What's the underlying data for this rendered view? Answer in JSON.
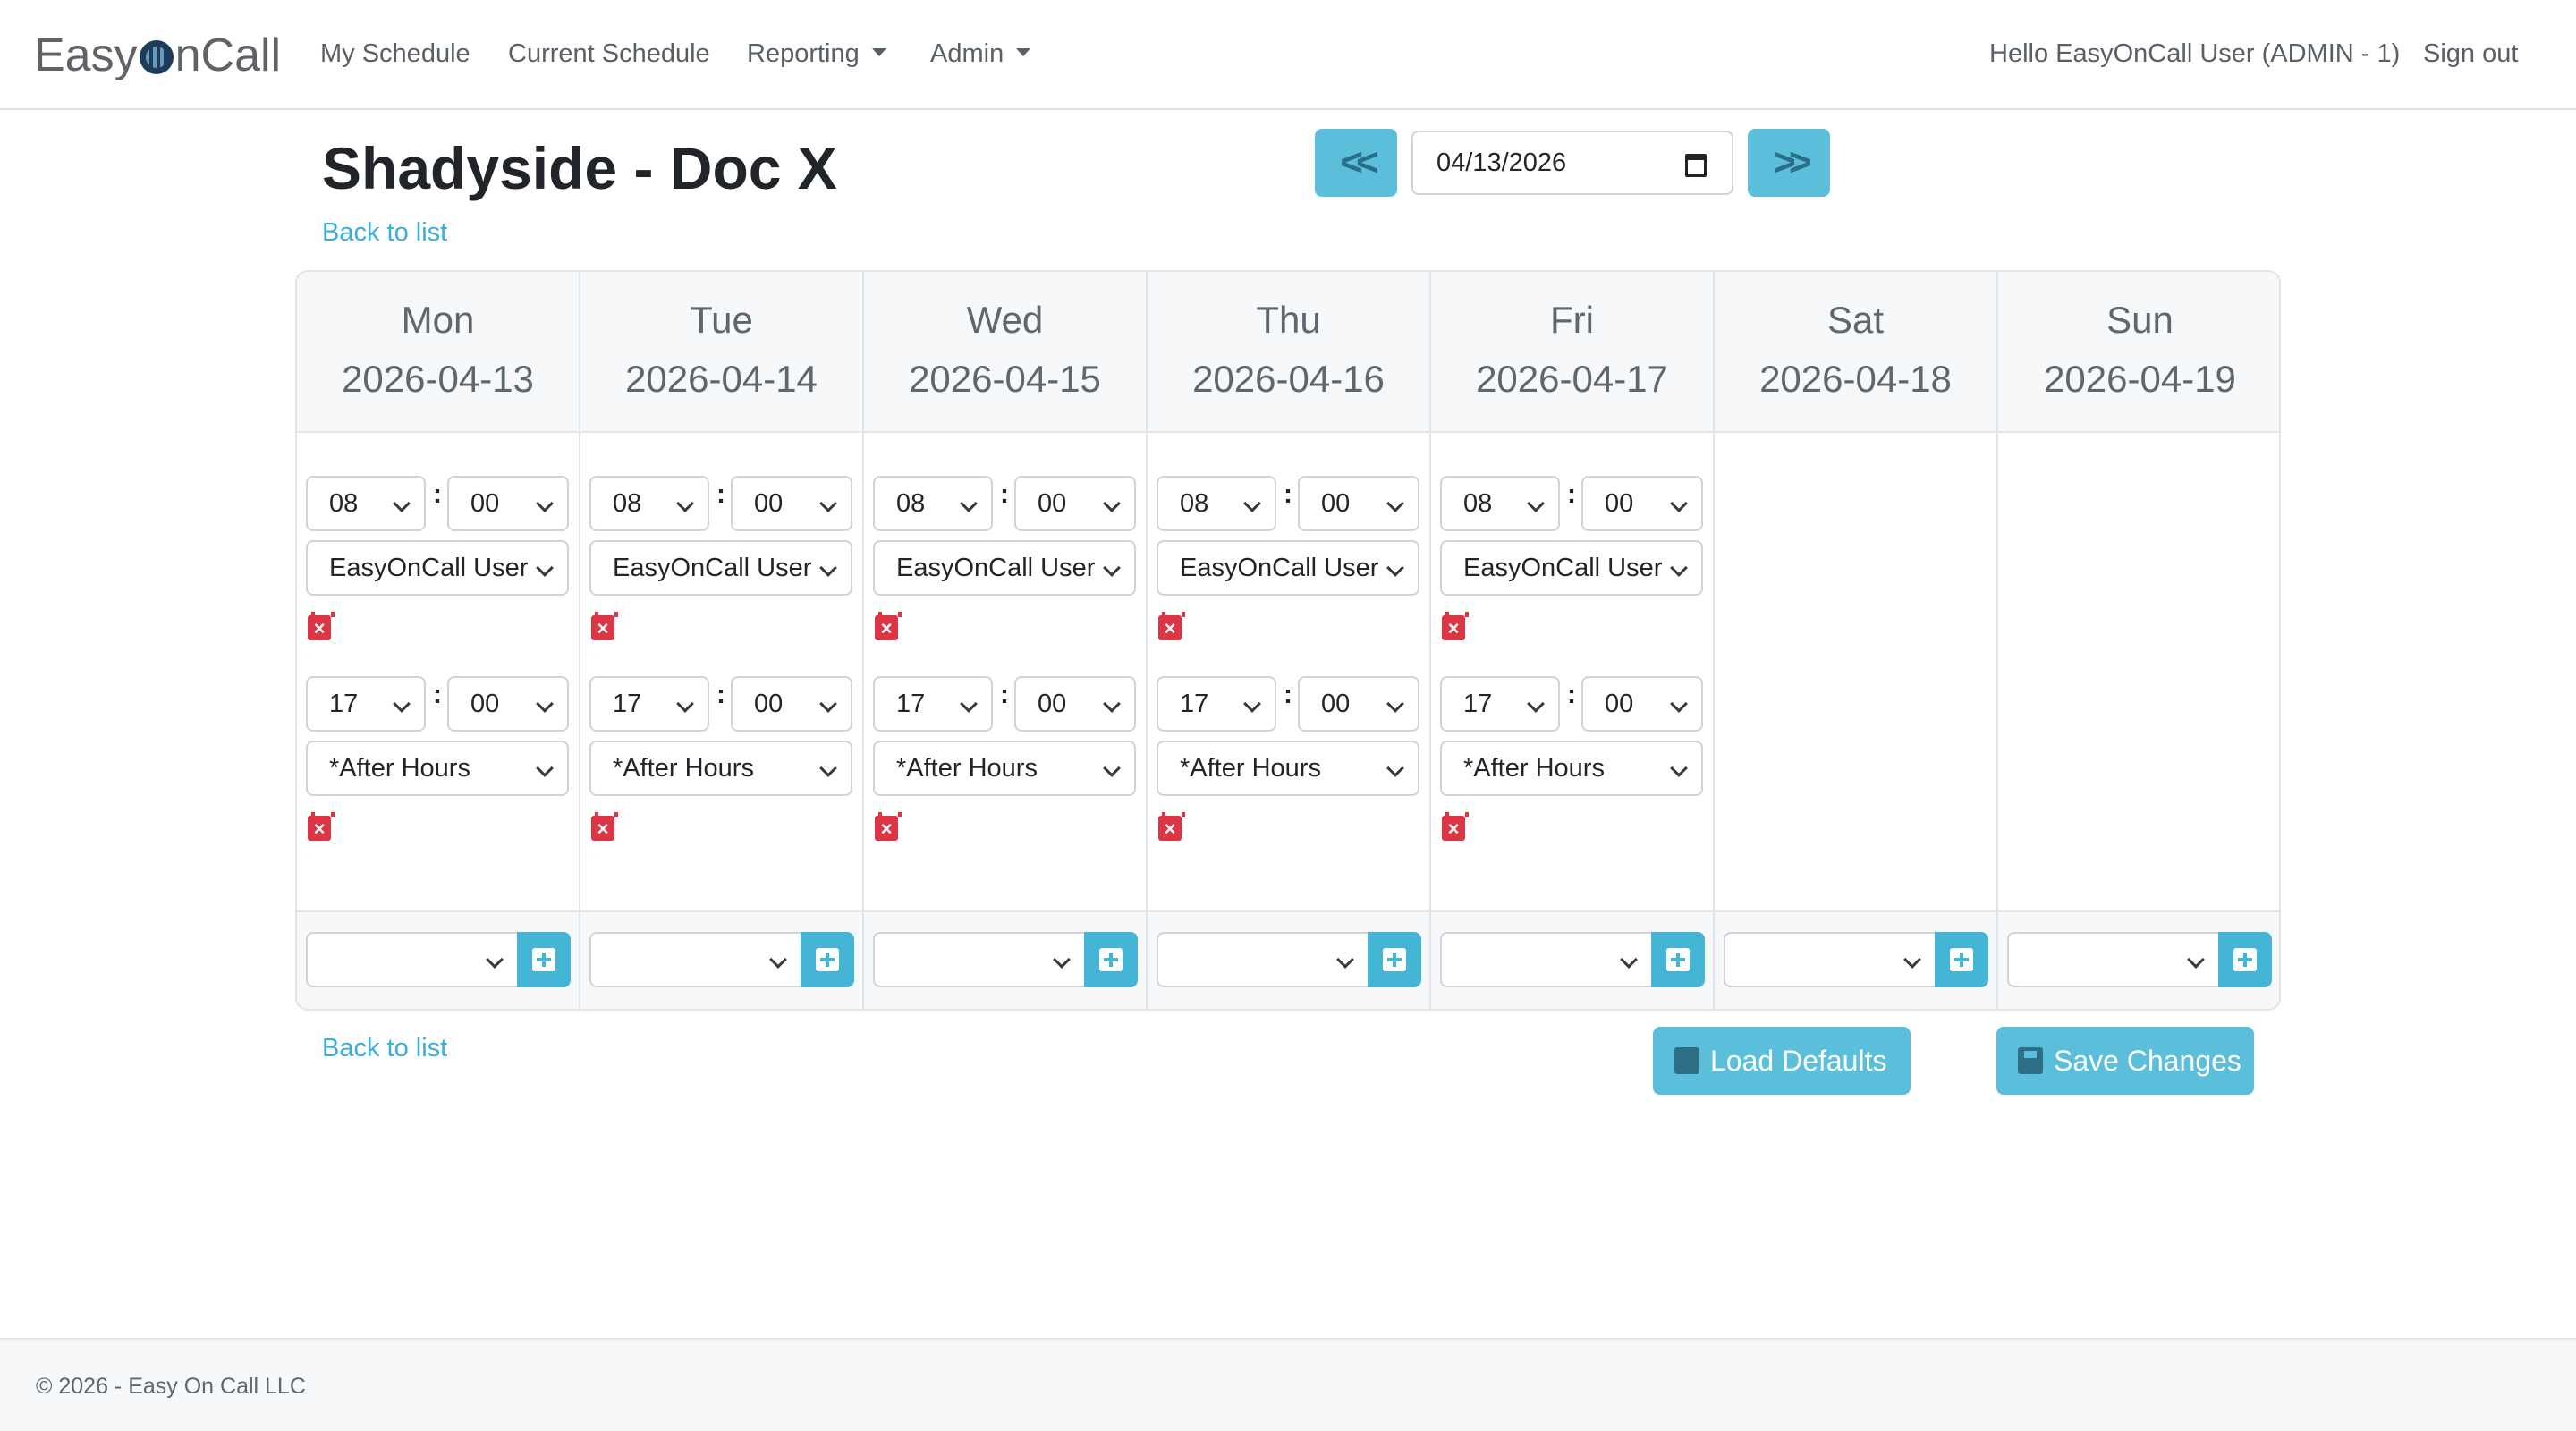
{
  "brand": {
    "prefix": "Easy",
    "mid": "n",
    "suffix": "Call"
  },
  "nav": {
    "my_schedule": "My Schedule",
    "current_schedule": "Current Schedule",
    "reporting": "Reporting",
    "admin": "Admin",
    "greeting": "Hello EasyOnCall User (ADMIN - 1)",
    "sign_out": "Sign out"
  },
  "page": {
    "title": "Shadyside - Doc X",
    "back_top": "Back to list",
    "back_bottom": "Back to list",
    "prev_label": "<<",
    "next_label": ">>",
    "date": "04/13/2026"
  },
  "days": [
    {
      "day": "Mon",
      "date": "2026-04-13"
    },
    {
      "day": "Tue",
      "date": "2026-04-14"
    },
    {
      "day": "Wed",
      "date": "2026-04-15"
    },
    {
      "day": "Thu",
      "date": "2026-04-16"
    },
    {
      "day": "Fri",
      "date": "2026-04-17"
    },
    {
      "day": "Sat",
      "date": "2026-04-18"
    },
    {
      "day": "Sun",
      "date": "2026-04-19"
    }
  ],
  "shifts": {
    "first": {
      "hour": "08",
      "minute": "00",
      "assignee": "EasyOnCall User"
    },
    "second": {
      "hour": "17",
      "minute": "00",
      "assignee": "*After Hours"
    }
  },
  "buttons": {
    "load_defaults": "Load Defaults",
    "save_changes": "Save Changes"
  },
  "footer": {
    "copyright": "© 2026 - Easy On Call LLC"
  },
  "colors": {
    "accent": "#5bbfdb",
    "danger": "#dc3545",
    "link": "#3aaed8"
  }
}
